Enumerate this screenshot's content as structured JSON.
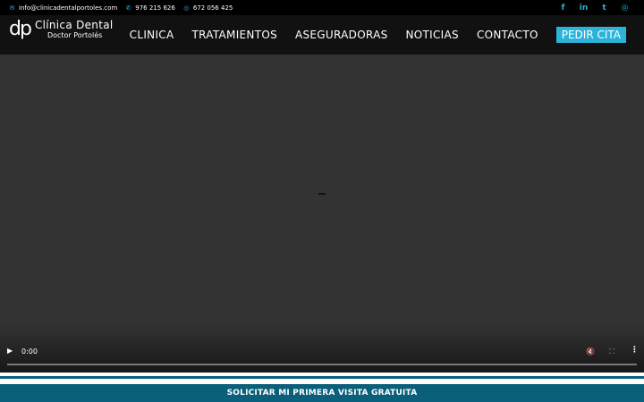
{
  "topbar": {
    "email": "info@clinicadentalportoles.com",
    "phone": "976 215 626",
    "whatsapp": "672 056 425",
    "email_icon": "✉",
    "phone_icon": "✆",
    "whatsapp_icon": "◎",
    "social": [
      {
        "name": "facebook",
        "glyph": "f"
      },
      {
        "name": "linkedin",
        "glyph": "in"
      },
      {
        "name": "twitter",
        "glyph": "t"
      },
      {
        "name": "instagram",
        "glyph": "◎"
      }
    ]
  },
  "logo": {
    "mark": "dp",
    "line1": "Clínica Dental",
    "line2": "Doctor Portolés"
  },
  "nav": {
    "items": [
      "CLINICA",
      "TRATAMIENTOS",
      "ASEGURADORAS",
      "NOTICIAS",
      "CONTACTO"
    ],
    "cta": "PEDIR CITA"
  },
  "video": {
    "time": "0:00",
    "play_icon": "▶",
    "mute_icon": "🔇",
    "fullscreen_icon": "⛶",
    "more_icon": "⋮"
  },
  "banner": {
    "label": "SOLICITAR MI PRIMERA VISITA GRATUITA"
  },
  "colors": {
    "accent": "#2bb3d9",
    "banner": "#0a5f7a",
    "video_bg": "#333333"
  }
}
